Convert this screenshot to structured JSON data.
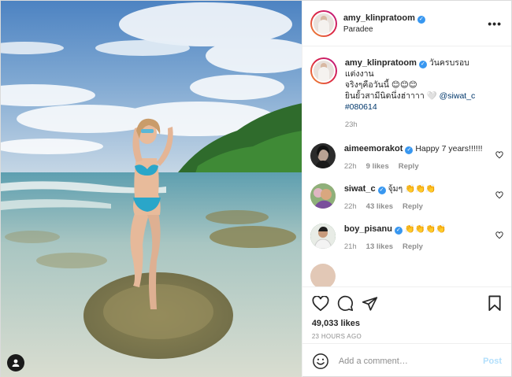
{
  "author": {
    "username": "amy_klinpratoom",
    "location": "Paradee"
  },
  "caption": {
    "username": "amy_klinpratoom",
    "text_line1": "วันครบรอบแต่งงาน",
    "text_line2": "จริงๆคือวันนี้ 😊😊😊",
    "text_line3": "ยินยั้วสามีนิดนึ่งฮ่าาาา 🤍 ",
    "mention": "@siwat_c",
    "hashtag": "#080614",
    "time": "23h"
  },
  "comments": [
    {
      "username": "aimeemorakot",
      "text": "Happy 7 years!!!!!!",
      "time": "22h",
      "likes": "9 likes",
      "reply": "Reply"
    },
    {
      "username": "siwat_c",
      "text": "จุ้มๆ 👏👏👏",
      "time": "22h",
      "likes": "43 likes",
      "reply": "Reply"
    },
    {
      "username": "boy_pisanu",
      "text": "👏👏👏👏",
      "time": "21h",
      "likes": "13 likes",
      "reply": "Reply"
    }
  ],
  "likes_count": "49,033 likes",
  "posted_ago": "23 HOURS AGO",
  "add_comment": {
    "placeholder": "Add a comment…",
    "post_label": "Post"
  },
  "more_label": "•••",
  "verified_mark": "✓",
  "colors": {
    "verified": "#3897f0",
    "link": "#00376b",
    "post_disabled": "#b2dffc",
    "muted": "#8e8e8e"
  }
}
